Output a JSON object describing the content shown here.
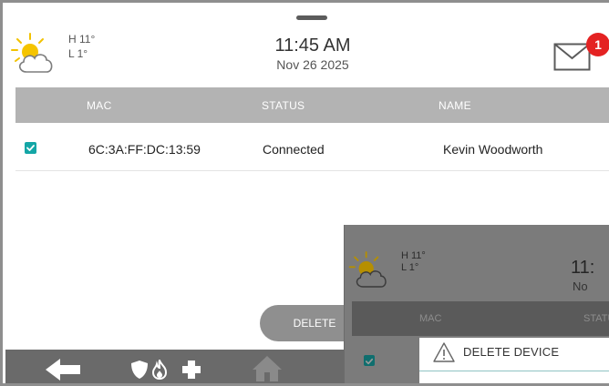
{
  "weather": {
    "high": "H 11°",
    "low": "L 1°",
    "icon": "partly-cloudy-icon"
  },
  "clock": {
    "time": "11:45 AM",
    "date": "Nov 26 2025"
  },
  "messages": {
    "icon": "envelope-icon",
    "unread_count": "1"
  },
  "table": {
    "columns": [
      "MAC",
      "STATUS",
      "NAME"
    ],
    "rows": [
      {
        "checked": true,
        "mac": "6C:3A:FF:DC:13:59",
        "status": "Connected",
        "name": "Kevin Woodworth"
      }
    ]
  },
  "actions": {
    "delete_label": "DELETE"
  },
  "nav": {
    "icons": [
      "back-arrow-icon",
      "shield-icon",
      "fire-icon",
      "medical-cross-icon",
      "home-icon"
    ]
  },
  "overlay": {
    "weather": {
      "high": "H 11°",
      "low": "L 1°"
    },
    "time_partial": "11:",
    "date_partial": "No",
    "columns": [
      "MAC",
      "STATU"
    ],
    "dialog_title": "DELETE DEVICE"
  },
  "colors": {
    "accent": "#14a6a6",
    "badge": "#e42222",
    "header_gray": "#b3b3b3"
  }
}
